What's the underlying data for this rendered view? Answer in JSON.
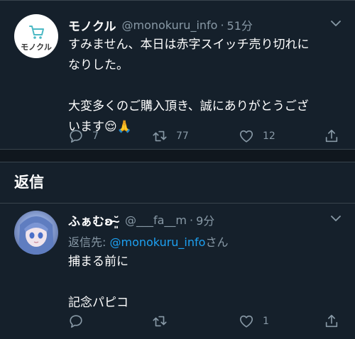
{
  "tweet1": {
    "display_name": "モノクル",
    "handle": "@monokuru_info",
    "separator": "·",
    "time": "51分",
    "avatar_text": "モノクル",
    "text": "すみません、本日は赤字スイッチ売り切れに\nなりした。\n\n大変多くのご購入頂き、誠にありがとうござ\nいます😌🙏",
    "reply_count": "7",
    "retweet_count": "77",
    "like_count": "12"
  },
  "replies_section": {
    "title": "返信"
  },
  "tweet2": {
    "display_name": "ふぁむʚ˘̴͈̆",
    "handle": "@___fa__m",
    "separator": "·",
    "time": "9分",
    "reply_to_prefix": "返信先: ",
    "reply_to_handle": "@monokuru_info",
    "reply_to_suffix": "さん",
    "text": "捕まる前に\n\n記念パピコ",
    "like_count": "1"
  },
  "colors": {
    "background": "#15202b",
    "secondary_text": "#8899a6",
    "link": "#1da1f2",
    "border": "#38444d",
    "logo_teal": "#4bb9c4"
  }
}
